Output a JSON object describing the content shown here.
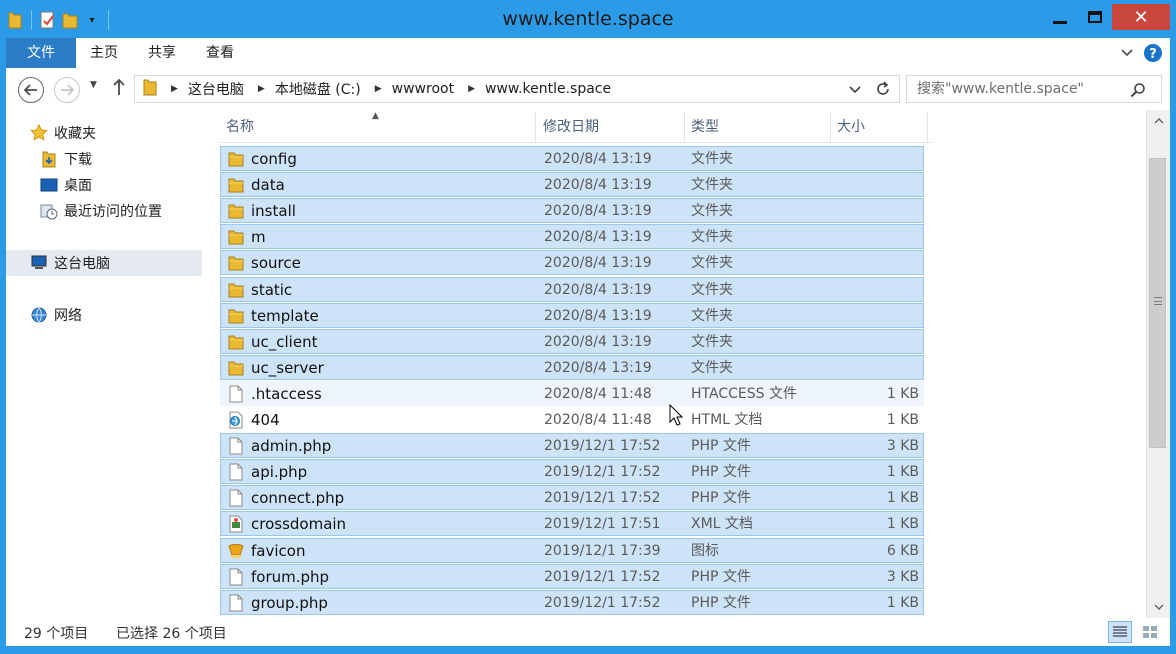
{
  "window": {
    "title": "www.kentle.space",
    "close_label": "✕"
  },
  "ribbon": {
    "tabs": [
      {
        "label": "文件"
      },
      {
        "label": "主页"
      },
      {
        "label": "共享"
      },
      {
        "label": "查看"
      }
    ]
  },
  "address": {
    "crumbs": [
      "这台电脑",
      "本地磁盘 (C:)",
      "wwwroot",
      "www.kentle.space"
    ],
    "search_placeholder": "搜索\"www.kentle.space\""
  },
  "nav": {
    "items": [
      {
        "label": "收藏夹",
        "icon": "star-icon"
      },
      {
        "label": "下载",
        "icon": "download-folder-icon"
      },
      {
        "label": "桌面",
        "icon": "desktop-icon"
      },
      {
        "label": "最近访问的位置",
        "icon": "recent-places-icon"
      },
      {
        "label": "这台电脑",
        "icon": "computer-icon"
      },
      {
        "label": "网络",
        "icon": "network-icon"
      }
    ]
  },
  "columns": {
    "name": "名称",
    "date": "修改日期",
    "type": "类型",
    "size": "大小"
  },
  "files": [
    {
      "name": "config",
      "date": "2020/8/4 13:19",
      "type": "文件夹",
      "size": "",
      "icon": "folder-icon",
      "selected": true
    },
    {
      "name": "data",
      "date": "2020/8/4 13:19",
      "type": "文件夹",
      "size": "",
      "icon": "folder-icon",
      "selected": true
    },
    {
      "name": "install",
      "date": "2020/8/4 13:19",
      "type": "文件夹",
      "size": "",
      "icon": "folder-icon",
      "selected": true
    },
    {
      "name": "m",
      "date": "2020/8/4 13:19",
      "type": "文件夹",
      "size": "",
      "icon": "folder-icon",
      "selected": true
    },
    {
      "name": "source",
      "date": "2020/8/4 13:19",
      "type": "文件夹",
      "size": "",
      "icon": "folder-icon",
      "selected": true
    },
    {
      "name": "static",
      "date": "2020/8/4 13:19",
      "type": "文件夹",
      "size": "",
      "icon": "folder-icon",
      "selected": true
    },
    {
      "name": "template",
      "date": "2020/8/4 13:19",
      "type": "文件夹",
      "size": "",
      "icon": "folder-icon",
      "selected": true
    },
    {
      "name": "uc_client",
      "date": "2020/8/4 13:19",
      "type": "文件夹",
      "size": "",
      "icon": "folder-icon",
      "selected": true
    },
    {
      "name": "uc_server",
      "date": "2020/8/4 13:19",
      "type": "文件夹",
      "size": "",
      "icon": "folder-icon",
      "selected": true
    },
    {
      "name": ".htaccess",
      "date": "2020/8/4 11:48",
      "type": "HTACCESS 文件",
      "size": "1 KB",
      "icon": "file-icon",
      "selected": false,
      "hover": true
    },
    {
      "name": "404",
      "date": "2020/8/4 11:48",
      "type": "HTML 文档",
      "size": "1 KB",
      "icon": "html-icon",
      "selected": false
    },
    {
      "name": "admin.php",
      "date": "2019/12/1 17:52",
      "type": "PHP 文件",
      "size": "3 KB",
      "icon": "file-icon",
      "selected": true
    },
    {
      "name": "api.php",
      "date": "2019/12/1 17:52",
      "type": "PHP 文件",
      "size": "1 KB",
      "icon": "file-icon",
      "selected": true
    },
    {
      "name": "connect.php",
      "date": "2019/12/1 17:52",
      "type": "PHP 文件",
      "size": "1 KB",
      "icon": "file-icon",
      "selected": true
    },
    {
      "name": "crossdomain",
      "date": "2019/12/1 17:51",
      "type": "XML 文档",
      "size": "1 KB",
      "icon": "xml-icon",
      "selected": true
    },
    {
      "name": "favicon",
      "date": "2019/12/1 17:39",
      "type": "图标",
      "size": "6 KB",
      "icon": "favicon-icon",
      "selected": true
    },
    {
      "name": "forum.php",
      "date": "2019/12/1 17:52",
      "type": "PHP 文件",
      "size": "3 KB",
      "icon": "file-icon",
      "selected": true
    },
    {
      "name": "group.php",
      "date": "2019/12/1 17:52",
      "type": "PHP 文件",
      "size": "1 KB",
      "icon": "file-icon",
      "selected": true
    }
  ],
  "status": {
    "count": "29 个项目",
    "selected": "已选择 26 个项目"
  },
  "colors": {
    "accent": "#2b9be8",
    "file_tab": "#2a7cc7",
    "selection": "#cde4f8",
    "close": "#c9463d",
    "folder": "#e8b931"
  }
}
